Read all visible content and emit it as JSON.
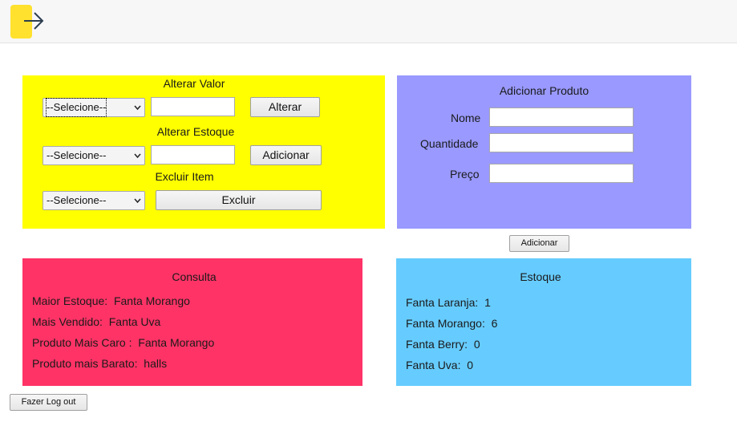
{
  "header": {
    "arrow_icon": "arrow-right-icon",
    "tile_color": "#ffe12e"
  },
  "alterar_valor": {
    "title": "Alterar Valor",
    "select_value": "--Selecione--",
    "input_value": "",
    "button_label": "Alterar"
  },
  "alterar_estoque": {
    "title": "Alterar Estoque",
    "select_value": "--Selecione--",
    "input_value": "",
    "button_label": "Adicionar"
  },
  "excluir_item": {
    "title": "Excluir Item",
    "select_value": "--Selecione--",
    "button_label": "Excluir"
  },
  "adicionar_produto": {
    "title": "Adicionar Produto",
    "nome_label": "Nome",
    "nome_value": "",
    "quantidade_label": "Quantidade",
    "quantidade_value": "",
    "preco_label": "Preço",
    "preco_value": "",
    "button_label": "Adicionar"
  },
  "consulta": {
    "title": "Consulta",
    "rows": [
      {
        "label": "Maior Estoque:",
        "value": "Fanta Morango"
      },
      {
        "label": "Mais Vendido:",
        "value": "Fanta Uva"
      },
      {
        "label": "Produto Mais Caro :",
        "value": "Fanta Morango"
      },
      {
        "label": "Produto mais Barato:",
        "value": "halls"
      }
    ]
  },
  "estoque": {
    "title": "Estoque",
    "rows": [
      {
        "label": "Fanta Laranja:",
        "value": "1"
      },
      {
        "label": "Fanta Morango:",
        "value": "6"
      },
      {
        "label": "Fanta Berry:",
        "value": "0"
      },
      {
        "label": "Fanta Uva:",
        "value": "0"
      }
    ]
  },
  "logout_label": "Fazer Log out",
  "colors": {
    "panel_yellow": "#ffff00",
    "panel_purple": "#9999ff",
    "panel_pink": "#ff3366",
    "panel_blue": "#66ccff"
  }
}
